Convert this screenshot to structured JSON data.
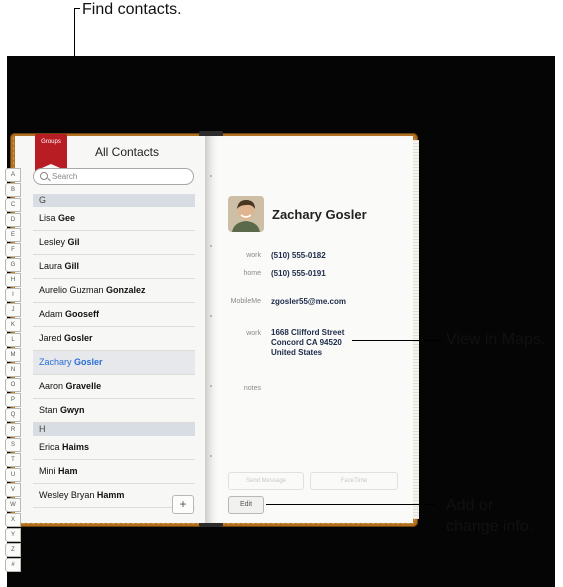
{
  "callouts": {
    "find_contacts": "Find contacts.",
    "view_in_maps": "View in Maps.",
    "add_line1": "Add or",
    "add_line2": "change info."
  },
  "index_letters": [
    "A",
    "B",
    "C",
    "D",
    "E",
    "F",
    "G",
    "H",
    "I",
    "J",
    "K",
    "L",
    "M",
    "N",
    "O",
    "P",
    "Q",
    "R",
    "S",
    "T",
    "U",
    "V",
    "W",
    "X",
    "Y",
    "Z",
    "#"
  ],
  "groups_label": "Groups",
  "list_title": "All Contacts",
  "search_placeholder": "Search",
  "contacts": [
    {
      "type": "section",
      "label": "G"
    },
    {
      "type": "row",
      "first": "Lisa",
      "last": "Gee"
    },
    {
      "type": "row",
      "first": "Lesley",
      "last": "Gil"
    },
    {
      "type": "row",
      "first": "Laura",
      "last": "Gill"
    },
    {
      "type": "row",
      "first": "Aurelio Guzman",
      "last": "Gonzalez"
    },
    {
      "type": "row",
      "first": "Adam",
      "last": "Gooseff"
    },
    {
      "type": "row",
      "first": "Jared",
      "last": "Gosler"
    },
    {
      "type": "row",
      "first": "Zachary",
      "last": "Gosler",
      "selected": true
    },
    {
      "type": "row",
      "first": "Aaron",
      "last": "Gravelle"
    },
    {
      "type": "row",
      "first": "Stan",
      "last": "Gwyn"
    },
    {
      "type": "section",
      "label": "H"
    },
    {
      "type": "row",
      "first": "Erica",
      "last": "Haims"
    },
    {
      "type": "row",
      "first": "Mini",
      "last": "Ham"
    },
    {
      "type": "row",
      "first": "Wesley Bryan",
      "last": "Hamm"
    }
  ],
  "add_button": "+",
  "detail": {
    "name": "Zachary Gosler",
    "work_label": "work",
    "work_phone": "(510) 555-0182",
    "home_label": "home",
    "home_phone": "(510) 555-0191",
    "mobileme_label": "MobileMe",
    "mobileme_value": "zgosler55@me.com",
    "address_label": "work",
    "address_line1": "1668 Clifford Street",
    "address_line2": "Concord CA 94520",
    "address_line3": "United States",
    "notes_label": "notes",
    "send_message": "Send Message",
    "facetime": "FaceTime",
    "edit": "Edit"
  },
  "colors": {
    "book_leather": "#b0701f",
    "ribbon": "#b81d24",
    "selected_text": "#2a6fd6"
  }
}
